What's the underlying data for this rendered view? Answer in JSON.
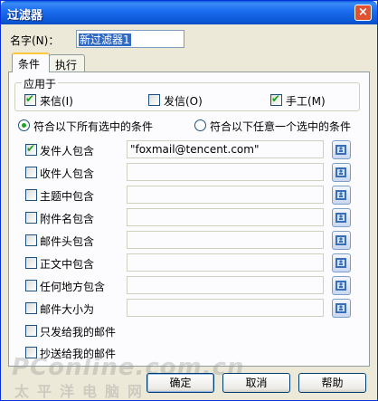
{
  "window": {
    "title": "过滤器",
    "close_label": "×"
  },
  "name_label": "名字(N)：",
  "name_value": "新过滤器1",
  "tabs": [
    {
      "label": "条件",
      "active": true
    },
    {
      "label": "执行",
      "active": false
    }
  ],
  "apply_group": {
    "title": "应用于",
    "options": [
      {
        "label": "来信(I)",
        "checked": true
      },
      {
        "label": "发信(O)",
        "checked": false
      },
      {
        "label": "手工(M)",
        "checked": true
      }
    ]
  },
  "match_mode": [
    {
      "label": "符合以下所有选中的条件",
      "selected": true
    },
    {
      "label": "符合以下任意一个选中的条件",
      "selected": false
    }
  ],
  "conditions": [
    {
      "label": "发件人包含",
      "checked": true,
      "value": "\"foxmail@tencent.com\""
    },
    {
      "label": "收件人包含",
      "checked": false,
      "value": ""
    },
    {
      "label": "主题中包含",
      "checked": false,
      "value": ""
    },
    {
      "label": "附件名包含",
      "checked": false,
      "value": ""
    },
    {
      "label": "邮件头包含",
      "checked": false,
      "value": ""
    },
    {
      "label": "正文中包含",
      "checked": false,
      "value": ""
    },
    {
      "label": "任何地方包含",
      "checked": false,
      "value": ""
    },
    {
      "label": "邮件大小为",
      "checked": false,
      "value": ""
    },
    {
      "label": "只发给我的邮件",
      "checked": false
    },
    {
      "label": "抄送给我的邮件",
      "checked": false
    }
  ],
  "buttons": {
    "ok": "确定",
    "cancel": "取消",
    "help": "帮助"
  },
  "watermark": {
    "logo": "PConline.com.cn",
    "sub": "太平洋电脑网"
  },
  "icons": {
    "picker": "address-book-icon"
  }
}
